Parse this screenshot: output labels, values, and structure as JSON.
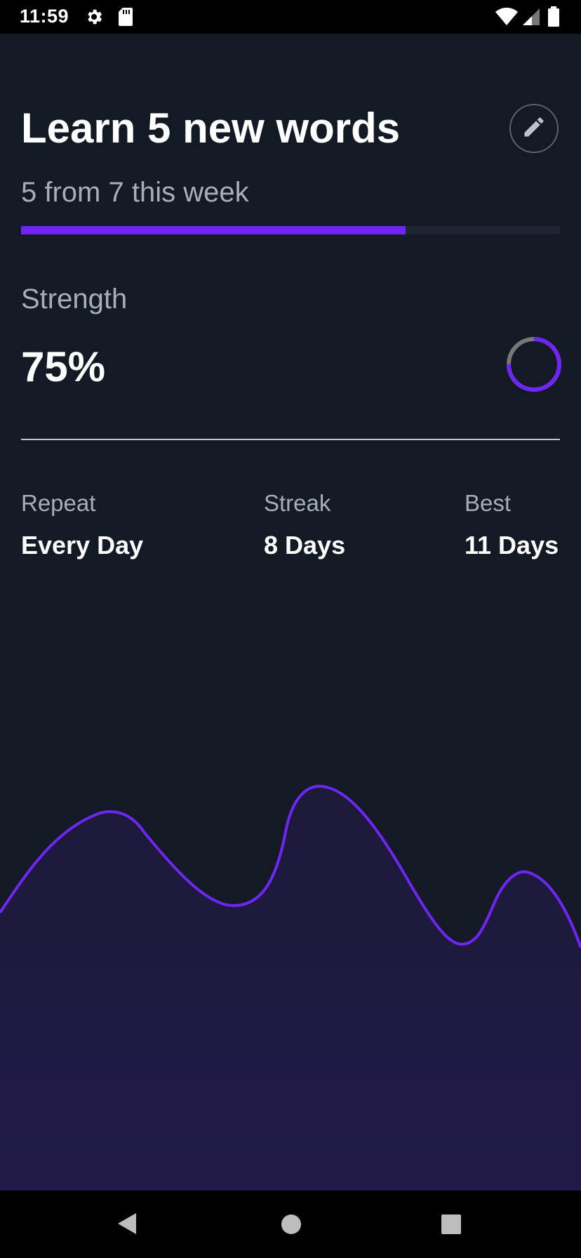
{
  "status_bar": {
    "time": "11:59",
    "icons": [
      "gear-icon",
      "sd-card-icon",
      "wifi-icon",
      "cell-signal-icon",
      "battery-icon"
    ]
  },
  "goal": {
    "title": "Learn 5 new words",
    "weekly_progress_text": "5 from 7 this week",
    "weekly_progress_fraction": 0.714
  },
  "strength": {
    "label": "Strength",
    "value_text": "75%",
    "value_fraction": 0.75
  },
  "stats": {
    "repeat": {
      "label": "Repeat",
      "value": "Every Day"
    },
    "streak": {
      "label": "Streak",
      "value": "8 Days"
    },
    "best": {
      "label": "Best",
      "value": "11 Days"
    }
  },
  "colors": {
    "background": "#141a25",
    "accent": "#6e25f5",
    "muted_text": "#a9adb5",
    "ring_track": "#777777",
    "chart_fill_top": "#1b1a38",
    "chart_fill_bottom": "#211a48"
  },
  "nav_bar": {
    "icons": [
      "back-icon",
      "home-icon",
      "recents-icon"
    ]
  }
}
